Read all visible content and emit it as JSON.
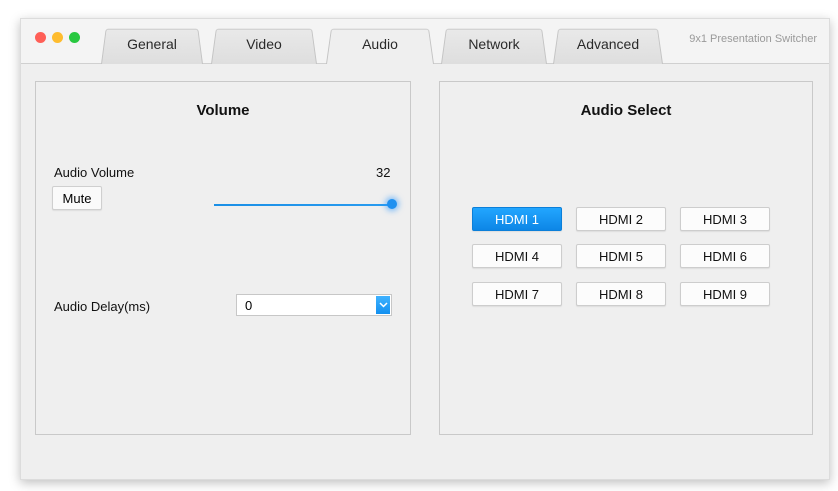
{
  "app": {
    "title": "9x1 Presentation Switcher"
  },
  "tabs": [
    {
      "label": "General",
      "active": false
    },
    {
      "label": "Video",
      "active": false
    },
    {
      "label": "Audio",
      "active": true
    },
    {
      "label": "Network",
      "active": false
    },
    {
      "label": "Advanced",
      "active": false
    }
  ],
  "volume_panel": {
    "title": "Volume",
    "volume_label": "Audio Volume",
    "volume_value": "32",
    "mute_label": "Mute",
    "delay_label": "Audio Delay(ms)",
    "delay_value": "0"
  },
  "audio_select": {
    "title": "Audio Select",
    "selected": "HDMI 1",
    "buttons": [
      "HDMI 1",
      "HDMI 2",
      "HDMI 3",
      "HDMI 4",
      "HDMI 5",
      "HDMI 6",
      "HDMI 7",
      "HDMI 8",
      "HDMI 9"
    ]
  },
  "colors": {
    "accent": "#1a8fe6",
    "traffic_red": "#ff5f57",
    "traffic_yellow": "#febc2e",
    "traffic_green": "#28c840"
  }
}
